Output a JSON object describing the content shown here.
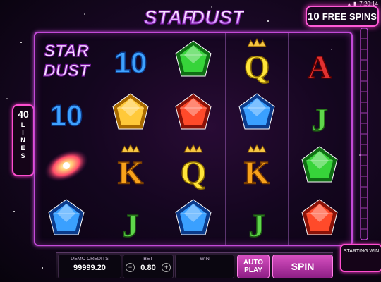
{
  "status_bar": {
    "time": "7:20:14",
    "battery_icon": "battery-icon",
    "wifi_icon": "wifi-icon"
  },
  "game": {
    "logo_top_line1": "STAR",
    "logo_top_line2": "DUST",
    "reel_logo_line1": "STAR",
    "reel_logo_line2": "DUST"
  },
  "free_spins": {
    "count": "10",
    "label": "FREE SPINS"
  },
  "lines_badge": {
    "count": "40",
    "word": "LINES"
  },
  "reels": [
    [
      "stardust-logo",
      "ten",
      "galaxy",
      "blue-gem"
    ],
    [
      "ten",
      "yellow-gem",
      "king",
      "jack"
    ],
    [
      "green-gem",
      "red-gem",
      "queen",
      "blue-gem"
    ],
    [
      "queen",
      "blue-gem",
      "king",
      "jack"
    ],
    [
      "ace",
      "jack",
      "green-gem",
      "red-gem"
    ]
  ],
  "symbol_text": {
    "ten": "10",
    "king": "K",
    "queen": "Q",
    "jack": "J",
    "ace": "A"
  },
  "colors": {
    "frame": "#c34ad8",
    "accent": "#ff4fcf",
    "button": "#b03aa6"
  },
  "bottom_bar": {
    "credits_label": "DEMO CREDITS",
    "credits_value": "99999.20",
    "bet_label": "BET",
    "bet_value": "0.80",
    "bet_minus": "−",
    "bet_plus": "+",
    "win_label": "WIN",
    "win_value": "",
    "autoplay_line1": "AUTO",
    "autoplay_line2": "PLAY",
    "spin_label": "SPIN"
  },
  "starting_win": {
    "label": "STARTING WIN"
  }
}
